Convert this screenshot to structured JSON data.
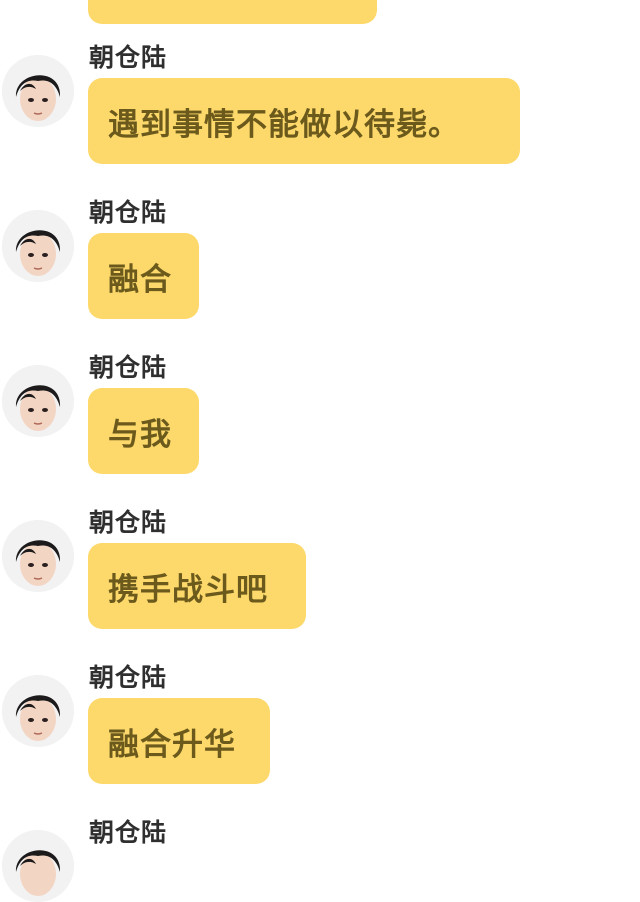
{
  "theme": {
    "bubble_color": "#fdd96b",
    "bubble_text_color": "#6b5a1c",
    "sender_color": "#2f2f2f",
    "background": "#ffffff"
  },
  "messages": [
    {
      "sender": "朝仓陆",
      "text": "遇到事情不能做以待毙。",
      "avatar_icon": "user-avatar-icon"
    },
    {
      "sender": "朝仓陆",
      "text": "融合",
      "avatar_icon": "user-avatar-icon"
    },
    {
      "sender": "朝仓陆",
      "text": "与我",
      "avatar_icon": "user-avatar-icon"
    },
    {
      "sender": "朝仓陆",
      "text": "携手战斗吧",
      "avatar_icon": "user-avatar-icon"
    },
    {
      "sender": "朝仓陆",
      "text": "融合升华",
      "avatar_icon": "user-avatar-icon"
    },
    {
      "sender": "朝仓陆",
      "text": "",
      "avatar_icon": "user-avatar-icon"
    }
  ]
}
